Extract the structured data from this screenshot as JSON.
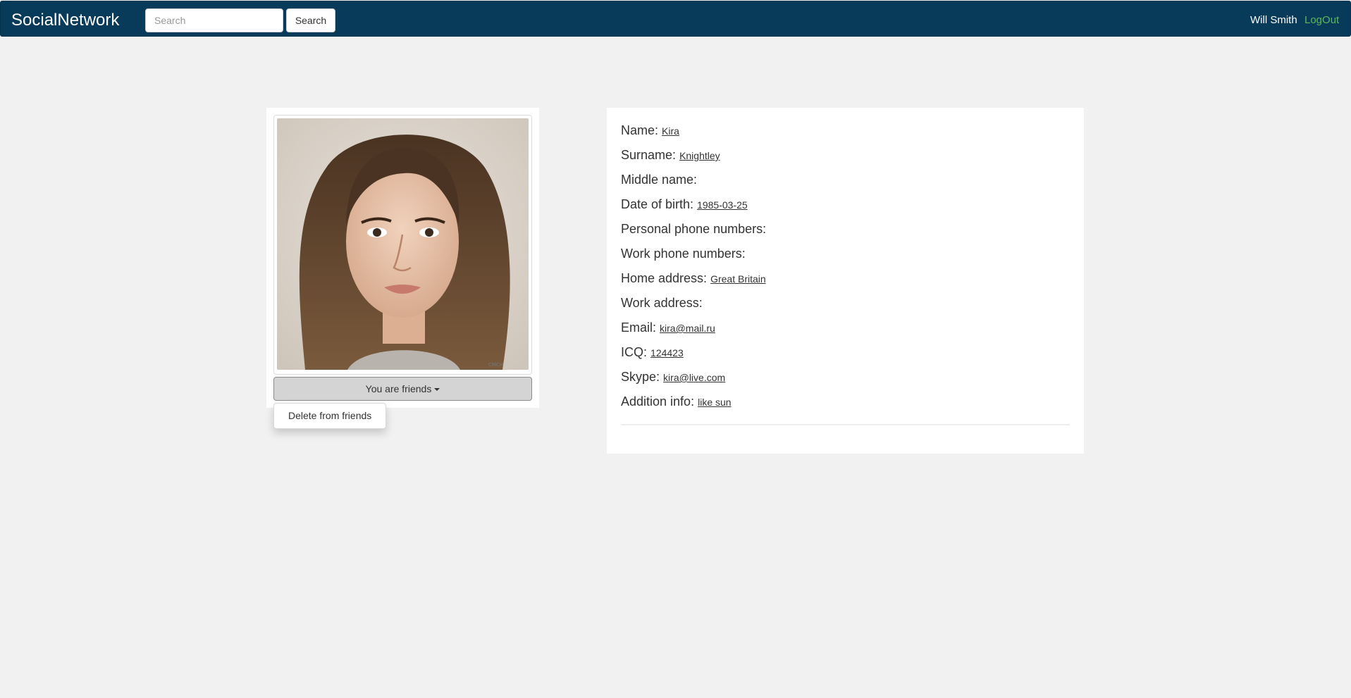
{
  "navbar": {
    "brand": "SocialNetwork",
    "search_placeholder": "Search",
    "search_button": "Search",
    "user_name": "Will Smith",
    "logout": "LogOut"
  },
  "profile": {
    "friend_status": "You are friends",
    "dropdown_items": [
      "Delete from friends"
    ],
    "fields": [
      {
        "label": "Name:",
        "value": "Kira"
      },
      {
        "label": "Surname:",
        "value": "Knightley"
      },
      {
        "label": "Middle name:",
        "value": ""
      },
      {
        "label": "Date of birth:",
        "value": "1985-03-25"
      },
      {
        "label": "Personal phone numbers:",
        "value": ""
      },
      {
        "label": "Work phone numbers:",
        "value": ""
      },
      {
        "label": "Home address:",
        "value": "Great Britain"
      },
      {
        "label": "Work address:",
        "value": ""
      },
      {
        "label": "Email:",
        "value": "kira@mail.ru"
      },
      {
        "label": "ICQ:",
        "value": "124423"
      },
      {
        "label": "Skype:",
        "value": "kira@live.com"
      },
      {
        "label": "Addition info:",
        "value": "like sun"
      }
    ]
  },
  "colors": {
    "navbar_bg": "#073b59",
    "logout_link": "#5cb85c",
    "page_bg": "#f1f1f1"
  }
}
